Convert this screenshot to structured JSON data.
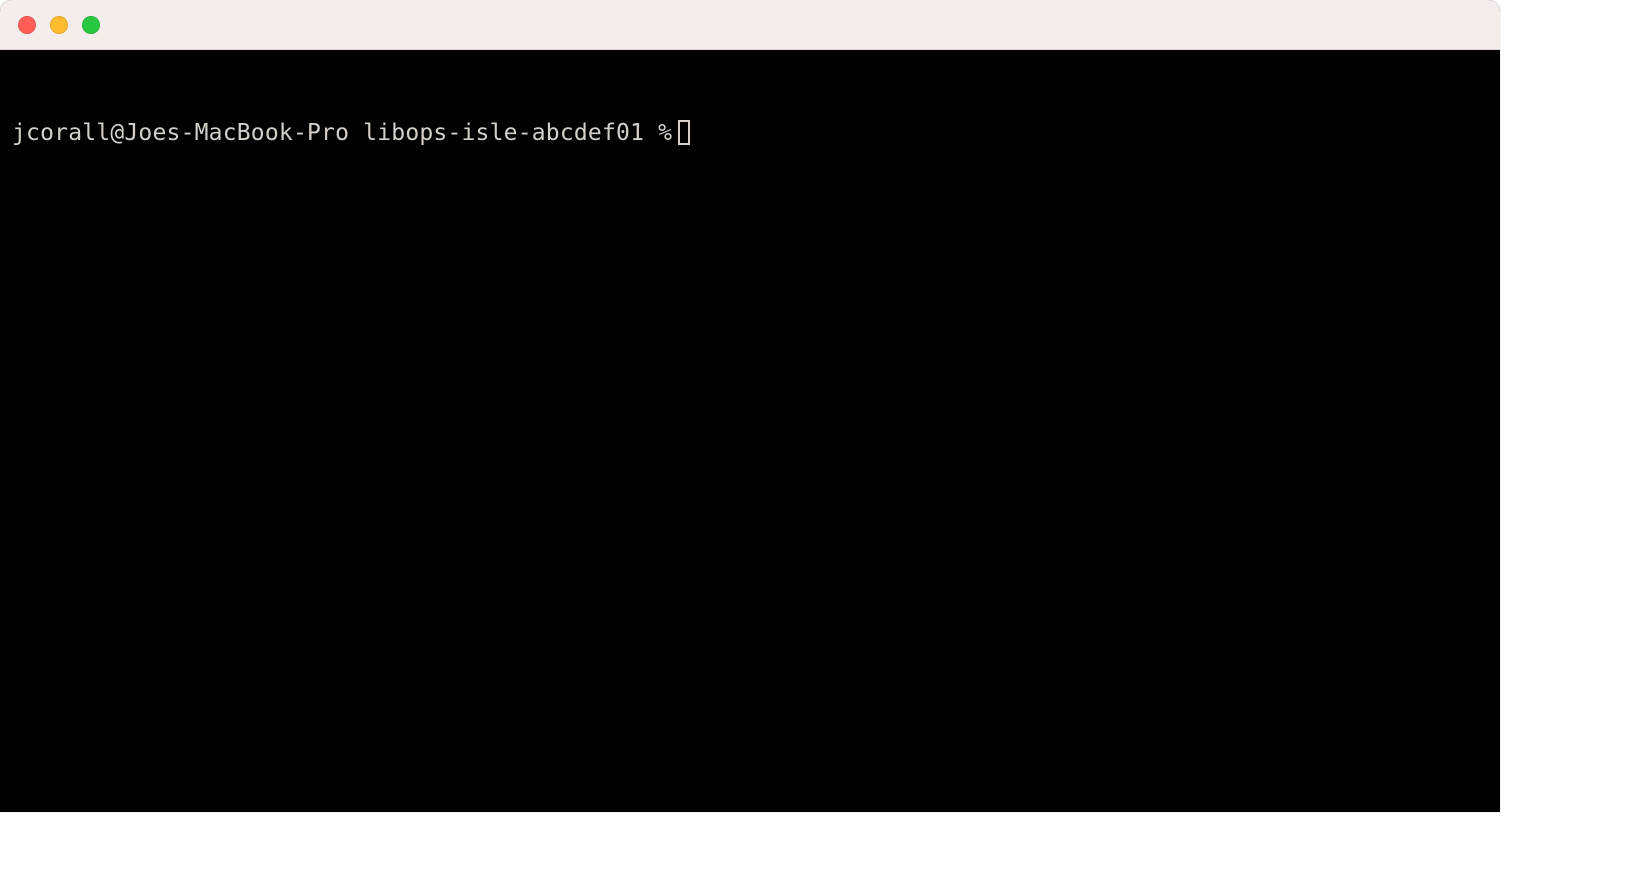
{
  "window": {
    "titlebar": {
      "close_color": "#ff5f57",
      "minimize_color": "#febc2e",
      "maximize_color": "#28c840",
      "background": "#f5edec"
    }
  },
  "terminal": {
    "prompt": "jcorall@Joes-MacBook-Pro libops-isle-abcdef01 %",
    "input_value": "",
    "background": "#000000",
    "foreground": "#d4cfc9"
  }
}
